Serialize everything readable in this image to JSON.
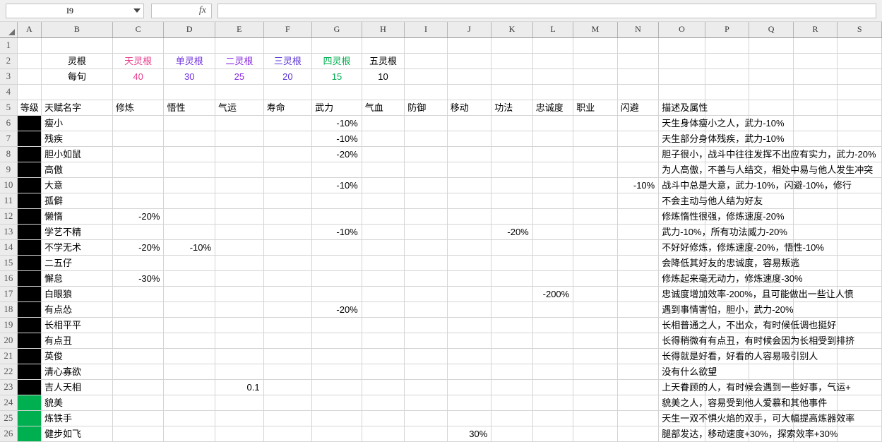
{
  "formula_bar": {
    "name_box_value": "I9",
    "fx_label": "fx",
    "input_value": ""
  },
  "columns": [
    "A",
    "B",
    "C",
    "D",
    "E",
    "F",
    "G",
    "H",
    "I",
    "J",
    "K",
    "L",
    "M",
    "N",
    "O",
    "P",
    "Q",
    "R",
    "S"
  ],
  "row_numbers": [
    "1",
    "2",
    "3",
    "4",
    "5",
    "6",
    "7",
    "8",
    "9",
    "10",
    "11",
    "12",
    "13",
    "14",
    "15",
    "16",
    "17",
    "18",
    "19",
    "20",
    "21",
    "22",
    "23",
    "24",
    "25",
    "26"
  ],
  "spirit_root": {
    "label": "灵根",
    "per_label": "每旬",
    "types": [
      {
        "name": "天灵根",
        "value": "40",
        "color": "#e83e8c"
      },
      {
        "name": "单灵根",
        "value": "30",
        "color": "#7030e0"
      },
      {
        "name": "二灵根",
        "value": "25",
        "color": "#8a2be2"
      },
      {
        "name": "三灵根",
        "value": "20",
        "color": "#5a35d6"
      },
      {
        "name": "四灵根",
        "value": "15",
        "color": "#00b050"
      },
      {
        "name": "五灵根",
        "value": "10",
        "color": "#000000"
      }
    ]
  },
  "table_headers": {
    "grade": "等级",
    "name": "天赋名字",
    "cultivation": "修炼",
    "comprehension": "悟性",
    "fortune": "气运",
    "lifespan": "寿命",
    "power": "武力",
    "vitality": "气血",
    "defense": "防御",
    "movement": "移动",
    "technique": "功法",
    "loyalty": "忠诚度",
    "profession": "职业",
    "evasion": "闪避",
    "description": "描述及属性"
  },
  "rows": [
    {
      "row": "6",
      "grade_fill": "black",
      "name": "瘦小",
      "cultivation": "",
      "comprehension": "",
      "fortune": "",
      "lifespan": "",
      "power": "-10%",
      "vitality": "",
      "defense": "",
      "movement": "",
      "technique": "",
      "loyalty": "",
      "profession": "",
      "evasion": "",
      "description": "天生身体瘦小之人，武力-10%"
    },
    {
      "row": "7",
      "grade_fill": "black",
      "name": "残疾",
      "cultivation": "",
      "comprehension": "",
      "fortune": "",
      "lifespan": "",
      "power": "-10%",
      "vitality": "",
      "defense": "",
      "movement": "",
      "technique": "",
      "loyalty": "",
      "profession": "",
      "evasion": "",
      "description": "天生部分身体残疾，武力-10%"
    },
    {
      "row": "8",
      "grade_fill": "black",
      "name": "胆小如鼠",
      "cultivation": "",
      "comprehension": "",
      "fortune": "",
      "lifespan": "",
      "power": "-20%",
      "vitality": "",
      "defense": "",
      "movement": "",
      "technique": "",
      "loyalty": "",
      "profession": "",
      "evasion": "",
      "description": "胆子很小，战斗中往往发挥不出应有实力，武力-20%"
    },
    {
      "row": "9",
      "grade_fill": "black",
      "name": "高傲",
      "cultivation": "",
      "comprehension": "",
      "fortune": "",
      "lifespan": "",
      "power": "",
      "vitality": "",
      "defense": "",
      "movement": "",
      "technique": "",
      "loyalty": "",
      "profession": "",
      "evasion": "",
      "description": "为人高傲，不善与人结交，相处中易与他人发生冲突"
    },
    {
      "row": "10",
      "grade_fill": "black",
      "name": "大意",
      "cultivation": "",
      "comprehension": "",
      "fortune": "",
      "lifespan": "",
      "power": "-10%",
      "vitality": "",
      "defense": "",
      "movement": "",
      "technique": "",
      "loyalty": "",
      "profession": "",
      "evasion": "-10%",
      "description": "战斗中总是大意，武力-10%，闪避-10%，修行"
    },
    {
      "row": "11",
      "grade_fill": "black",
      "name": "孤僻",
      "cultivation": "",
      "comprehension": "",
      "fortune": "",
      "lifespan": "",
      "power": "",
      "vitality": "",
      "defense": "",
      "movement": "",
      "technique": "",
      "loyalty": "",
      "profession": "",
      "evasion": "",
      "description": "不会主动与他人结为好友"
    },
    {
      "row": "12",
      "grade_fill": "black",
      "name": "懒惰",
      "cultivation": "-20%",
      "comprehension": "",
      "fortune": "",
      "lifespan": "",
      "power": "",
      "vitality": "",
      "defense": "",
      "movement": "",
      "technique": "",
      "loyalty": "",
      "profession": "",
      "evasion": "",
      "description": "修炼惰性很强，修炼速度-20%"
    },
    {
      "row": "13",
      "grade_fill": "black",
      "name": "学艺不精",
      "cultivation": "",
      "comprehension": "",
      "fortune": "",
      "lifespan": "",
      "power": "-10%",
      "vitality": "",
      "defense": "",
      "movement": "",
      "technique": "-20%",
      "loyalty": "",
      "profession": "",
      "evasion": "",
      "description": "武力-10%，所有功法威力-20%"
    },
    {
      "row": "14",
      "grade_fill": "black",
      "name": "不学无术",
      "cultivation": "-20%",
      "comprehension": "-10%",
      "fortune": "",
      "lifespan": "",
      "power": "",
      "vitality": "",
      "defense": "",
      "movement": "",
      "technique": "",
      "loyalty": "",
      "profession": "",
      "evasion": "",
      "description": "不好好修炼，修炼速度-20%，悟性-10%"
    },
    {
      "row": "15",
      "grade_fill": "black",
      "name": "二五仔",
      "cultivation": "",
      "comprehension": "",
      "fortune": "",
      "lifespan": "",
      "power": "",
      "vitality": "",
      "defense": "",
      "movement": "",
      "technique": "",
      "loyalty": "",
      "profession": "",
      "evasion": "",
      "description": "会降低其好友的忠诚度，容易叛逃"
    },
    {
      "row": "16",
      "grade_fill": "black",
      "name": "懈怠",
      "cultivation": "-30%",
      "comprehension": "",
      "fortune": "",
      "lifespan": "",
      "power": "",
      "vitality": "",
      "defense": "",
      "movement": "",
      "technique": "",
      "loyalty": "",
      "profession": "",
      "evasion": "",
      "description": "修炼起来毫无动力，修炼速度-30%"
    },
    {
      "row": "17",
      "grade_fill": "black",
      "name": "白眼狼",
      "cultivation": "",
      "comprehension": "",
      "fortune": "",
      "lifespan": "",
      "power": "",
      "vitality": "",
      "defense": "",
      "movement": "",
      "technique": "",
      "loyalty": "-200%",
      "profession": "",
      "evasion": "",
      "description": "忠诚度增加效率-200%，且可能做出一些让人愤"
    },
    {
      "row": "18",
      "grade_fill": "black",
      "name": "有点怂",
      "cultivation": "",
      "comprehension": "",
      "fortune": "",
      "lifespan": "",
      "power": "-20%",
      "vitality": "",
      "defense": "",
      "movement": "",
      "technique": "",
      "loyalty": "",
      "profession": "",
      "evasion": "",
      "description": "遇到事情害怕，胆小，武力-20%"
    },
    {
      "row": "19",
      "grade_fill": "black",
      "name": "长相平平",
      "cultivation": "",
      "comprehension": "",
      "fortune": "",
      "lifespan": "",
      "power": "",
      "vitality": "",
      "defense": "",
      "movement": "",
      "technique": "",
      "loyalty": "",
      "profession": "",
      "evasion": "",
      "description": "长相普通之人，不出众，有时候低调也挺好"
    },
    {
      "row": "20",
      "grade_fill": "black",
      "name": "有点丑",
      "cultivation": "",
      "comprehension": "",
      "fortune": "",
      "lifespan": "",
      "power": "",
      "vitality": "",
      "defense": "",
      "movement": "",
      "technique": "",
      "loyalty": "",
      "profession": "",
      "evasion": "",
      "description": "长得稍微有有点丑，有时候会因为长相受到排挤"
    },
    {
      "row": "21",
      "grade_fill": "black",
      "name": "英俊",
      "cultivation": "",
      "comprehension": "",
      "fortune": "",
      "lifespan": "",
      "power": "",
      "vitality": "",
      "defense": "",
      "movement": "",
      "technique": "",
      "loyalty": "",
      "profession": "",
      "evasion": "",
      "description": "长得就是好看，好看的人容易吸引别人"
    },
    {
      "row": "22",
      "grade_fill": "black",
      "name": "清心寡欲",
      "cultivation": "",
      "comprehension": "",
      "fortune": "",
      "lifespan": "",
      "power": "",
      "vitality": "",
      "defense": "",
      "movement": "",
      "technique": "",
      "loyalty": "",
      "profession": "",
      "evasion": "",
      "description": "没有什么欲望"
    },
    {
      "row": "23",
      "grade_fill": "black",
      "name": "吉人天相",
      "cultivation": "",
      "comprehension": "",
      "fortune": "0.1",
      "lifespan": "",
      "power": "",
      "vitality": "",
      "defense": "",
      "movement": "",
      "technique": "",
      "loyalty": "",
      "profession": "",
      "evasion": "",
      "description": "上天眷顾的人，有时候会遇到一些好事，气运+"
    },
    {
      "row": "24",
      "grade_fill": "green",
      "name": "貌美",
      "cultivation": "",
      "comprehension": "",
      "fortune": "",
      "lifespan": "",
      "power": "",
      "vitality": "",
      "defense": "",
      "movement": "",
      "technique": "",
      "loyalty": "",
      "profession": "",
      "evasion": "",
      "description": "貌美之人，容易受到他人爱慕和其他事件"
    },
    {
      "row": "25",
      "grade_fill": "green",
      "name": "炼铁手",
      "cultivation": "",
      "comprehension": "",
      "fortune": "",
      "lifespan": "",
      "power": "",
      "vitality": "",
      "defense": "",
      "movement": "",
      "technique": "",
      "loyalty": "",
      "profession": "",
      "evasion": "",
      "description": "天生一双不惧火焰的双手，可大幅提高炼器效率"
    },
    {
      "row": "26",
      "grade_fill": "green",
      "name": "健步如飞",
      "cultivation": "",
      "comprehension": "",
      "fortune": "",
      "lifespan": "",
      "power": "",
      "vitality": "",
      "defense": "",
      "movement": "30%",
      "technique": "",
      "loyalty": "",
      "profession": "",
      "evasion": "",
      "description": "腿部发达，移动速度+30%，探索效率+30%"
    }
  ]
}
